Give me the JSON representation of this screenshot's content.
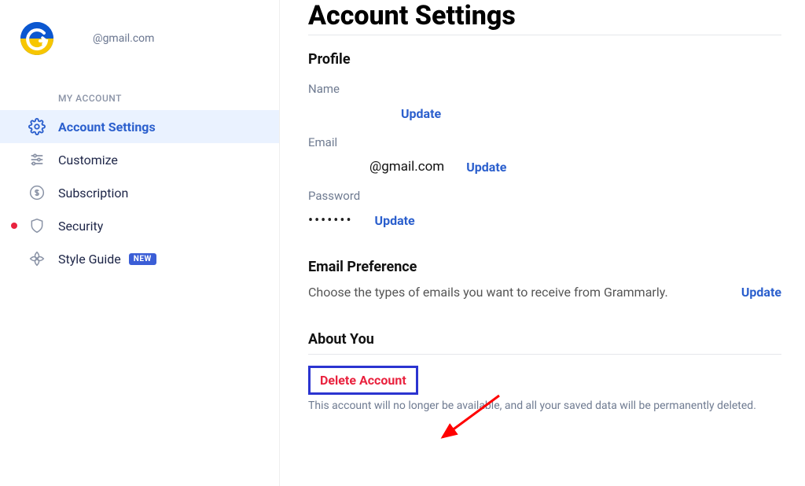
{
  "sidebar": {
    "user_email": "@gmail.com",
    "section_label": "MY ACCOUNT",
    "items": [
      {
        "label": "Account Settings"
      },
      {
        "label": "Customize"
      },
      {
        "label": "Subscription"
      },
      {
        "label": "Security"
      },
      {
        "label": "Style Guide",
        "badge": "NEW"
      }
    ]
  },
  "main": {
    "page_title": "Account Settings",
    "profile": {
      "heading": "Profile",
      "name_label": "Name",
      "name_update": "Update",
      "email_label": "Email",
      "email_value": "@gmail.com",
      "email_update": "Update",
      "password_label": "Password",
      "password_value": "•••••••",
      "password_update": "Update"
    },
    "email_pref": {
      "heading": "Email Preference",
      "text": "Choose the types of emails you want to receive from Grammarly.",
      "update": "Update"
    },
    "about": {
      "heading": "About You",
      "delete_label": "Delete Account",
      "delete_desc": "This account will no longer be available, and all your saved data will be permanently deleted."
    }
  }
}
